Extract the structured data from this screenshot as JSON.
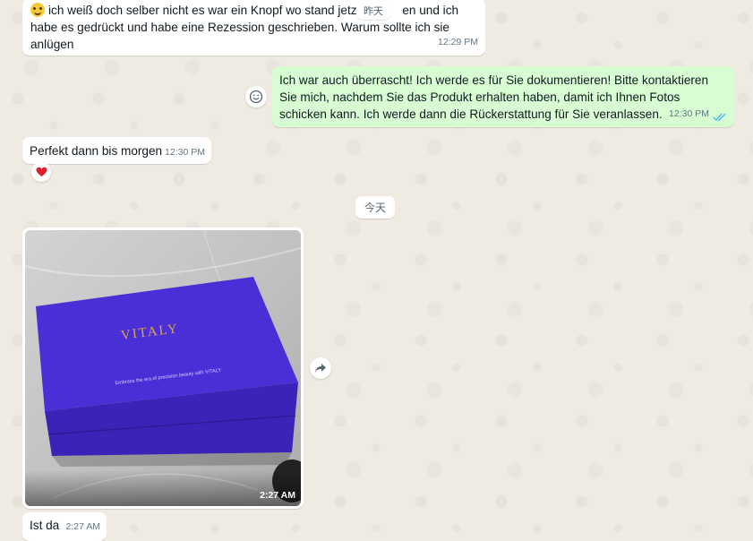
{
  "chat": {
    "messages": [
      {
        "text_part1": "ich weiß doch selber nicht es war ein Knopf wo stand jetzt",
        "text_part2": "en und ich habe es gedrückt und habe eine Rezession geschrieben. Warum sollte ich sie anlügen",
        "time": "12:29 PM"
      },
      {
        "text": "Ich war auch überrascht! Ich werde es für Sie dokumentieren! Bitte kontaktieren Sie mich, nachdem Sie das Produkt erhalten haben, damit ich Ihnen Fotos schicken kann. Ich werde dann die Rückerstattung für Sie veranlassen.",
        "time": "12:30 PM"
      },
      {
        "text": "Perfekt dann bis morgen",
        "time": "12:30 PM",
        "reaction": "❤️"
      },
      {
        "image_brand": "VITALY",
        "image_tagline": "Embrace the era of precision beauty with VITALY",
        "time": "2:27 AM"
      },
      {
        "text": "Ist da",
        "time": "2:27 AM"
      }
    ],
    "date_chips": {
      "yesterday": "昨天",
      "today": "今天"
    }
  },
  "colors": {
    "chat_background": "#efeae2",
    "incoming_bubble": "#ffffff",
    "outgoing_bubble": "#d9fdd3",
    "read_ticks": "#53bdeb",
    "box_color": "#4a2fd6"
  },
  "icons": {
    "emoji": "grinning-sweat-emoji",
    "react": "smiley-icon",
    "forward": "forward-icon",
    "read": "double-check-icon"
  }
}
